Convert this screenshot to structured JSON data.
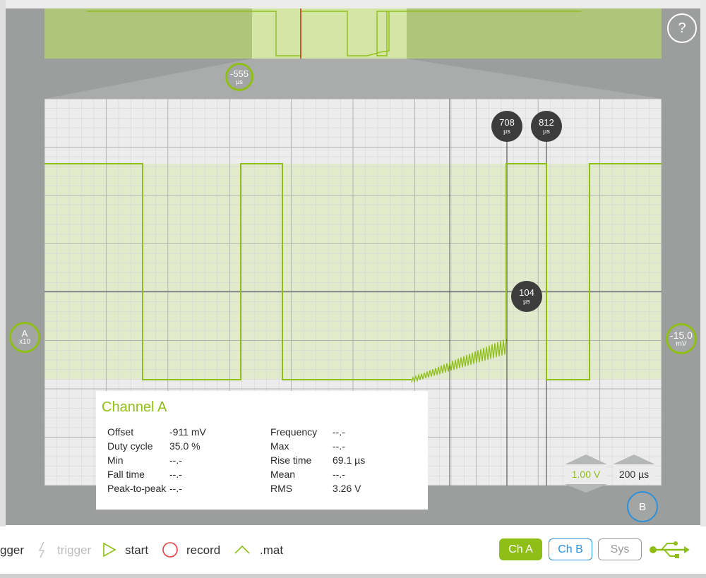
{
  "toolbar": {
    "trigger_partial": "gger",
    "trigger_label": "trigger",
    "start_label": "start",
    "record_label": "record",
    "export_label": ".mat"
  },
  "channels": {
    "a_label": "Ch A",
    "b_label": "Ch B",
    "sys_label": "Sys"
  },
  "markers": {
    "offset_value": "-555",
    "offset_unit": "µs",
    "cursor1_value": "708",
    "cursor1_unit": "µs",
    "cursor2_value": "812",
    "cursor2_unit": "µs",
    "delta_value": "104",
    "delta_unit": "µs",
    "channel_a_label": "A",
    "channel_a_gain": "x10",
    "trigger_level_value": "-15.0",
    "trigger_level_unit": "mV",
    "channel_b_label": "B"
  },
  "help_label": "?",
  "scales": {
    "voltage": "1.00 V",
    "time": "200 µs"
  },
  "measurements": {
    "title": "Channel A",
    "left": [
      {
        "label": "Offset",
        "value": "-911  mV"
      },
      {
        "label": "Duty cycle",
        "value": "35.0  %"
      },
      {
        "label": "Min",
        "value": "--.-"
      },
      {
        "label": "Fall time",
        "value": "--.-"
      },
      {
        "label": "Peak-to-peak",
        "value": "--.-"
      }
    ],
    "right": [
      {
        "label": "Frequency",
        "value": "--.-"
      },
      {
        "label": "Max",
        "value": "--.-"
      },
      {
        "label": "Rise time",
        "value": "69.1  µs"
      },
      {
        "label": "Mean",
        "value": "--.-"
      },
      {
        "label": "RMS",
        "value": "3.26  V"
      }
    ]
  },
  "colors": {
    "signal": "#8fbf17",
    "channel_b": "#2d90d8",
    "cursor": "#3c3c3c"
  }
}
